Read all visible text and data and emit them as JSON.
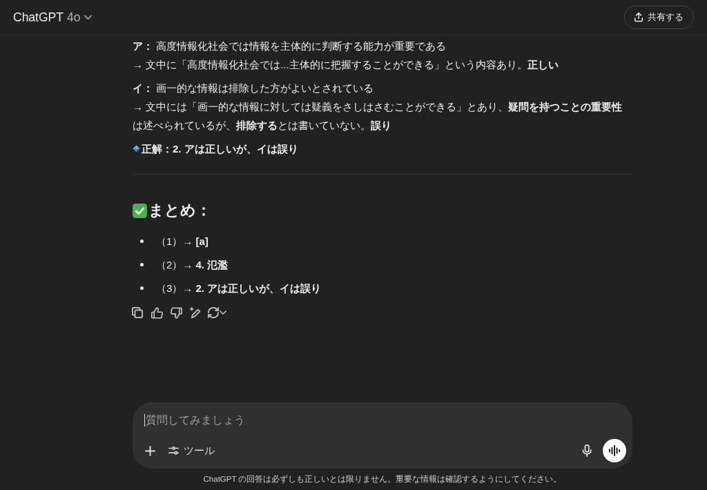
{
  "header": {
    "title": "ChatGPT",
    "model": "4o",
    "share_button": "共有する"
  },
  "message": {
    "blocks": [
      {
        "kind": "paragraph",
        "lines": [
          "**ア：** 高度情報化社会では情報を主体的に判断する能力が重要である",
          "→ 文中に「高度情報化社会では...主体的に把握することができる」という内容あり。**正しい**"
        ]
      },
      {
        "kind": "paragraph",
        "lines": [
          "**イ：** 画一的な情報は排除した方がよいとされている",
          "→ 文中には「画一的な情報に対しては疑義をさしはさむことができる」とあり、**疑問を持つことの重要性**は述べられているが、**排除する**とは書いていない。**誤り**"
        ]
      },
      {
        "kind": "answer",
        "text": "正解：2. アは正しいが、イは誤り"
      },
      {
        "kind": "divider"
      },
      {
        "kind": "heading",
        "text": "まとめ："
      },
      {
        "kind": "list",
        "items": [
          "（1）→ **[a]**",
          "（2）→ **4. 氾濫**",
          "（3）→ **2. アは正しいが、イは誤り**"
        ]
      }
    ]
  },
  "composer": {
    "placeholder": "質問してみましょう",
    "tools_button": "ツール"
  },
  "footer": {
    "disclaimer": "ChatGPT の回答は必ずしも正しいとは限りません。重要な情報は確認するようにしてください。"
  }
}
